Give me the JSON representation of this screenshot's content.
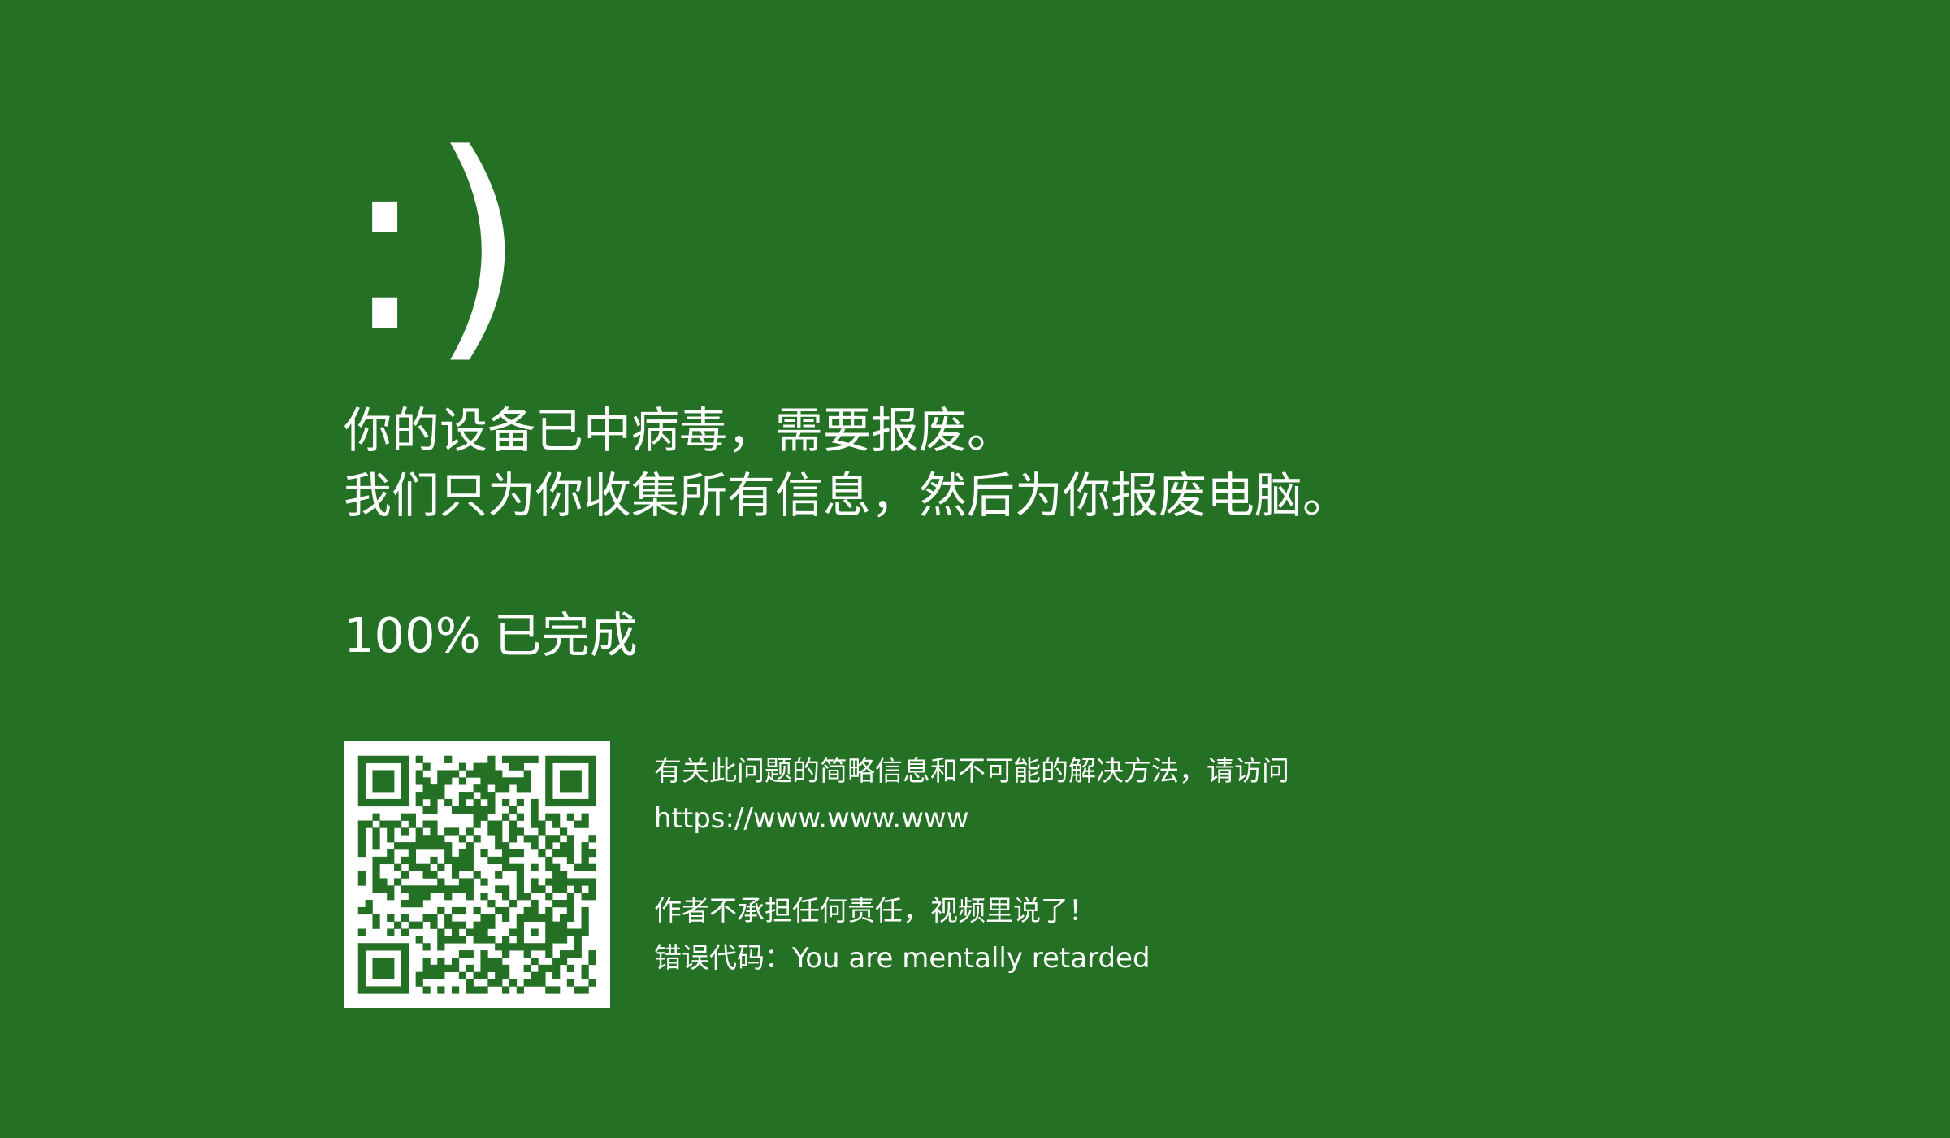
{
  "screen": {
    "background_color": "#247024",
    "text_color": "#ffffff",
    "emoticon": ":)",
    "message_line_1": "你的设备已中病毒，需要报废。",
    "message_line_2": "我们只为你收集所有信息，然后为你报废电脑。",
    "progress": {
      "value": "100%",
      "label": "已完成"
    },
    "qr_code": {
      "icon": "qr-code-icon",
      "foreground_color": "#247024",
      "background_color": "#ffffff"
    },
    "info": {
      "line_1": "有关此问题的简略信息和不可能的解决方法，请访问",
      "url": "https://www.www.www",
      "disclaimer": "作者不承担任何责任，视频里说了！",
      "error_code_label": "错误代码：",
      "error_code_value": "You are mentally retarded"
    }
  }
}
